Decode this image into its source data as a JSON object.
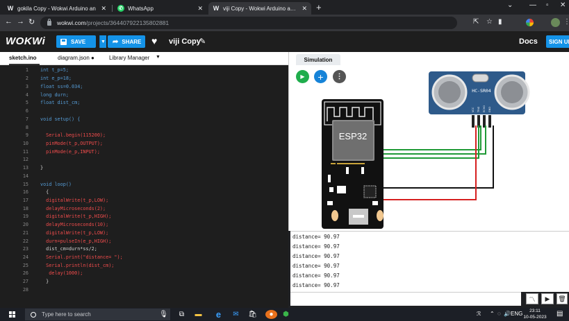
{
  "browser": {
    "tabs": [
      {
        "label": "gokila Copy - Wokwi Arduino an",
        "favicon": "W",
        "active": false
      },
      {
        "label": "WhatsApp",
        "favicon": "whatsapp",
        "active": false
      },
      {
        "label": "viji Copy - Wokwi Arduino and E",
        "favicon": "W",
        "active": true
      }
    ],
    "url_host": "wokwi.com",
    "url_path": "/projects/364407922135802881"
  },
  "wokwi": {
    "logo": "WOKWi",
    "save_label": "SAVE",
    "share_label": "SHARE",
    "project_name": "viji Copy",
    "docs_label": "Docs",
    "signup_label": "SIGN UP"
  },
  "editor": {
    "tabs": [
      "sketch.ino",
      "diagram.json ●",
      "Library Manager"
    ],
    "line_numbers": [
      "1",
      "2",
      "3",
      "4",
      "5",
      "6",
      "7",
      "8",
      "9",
      "10",
      "11",
      "12",
      "13",
      "14",
      "15",
      "16",
      "17",
      "18",
      "19",
      "20",
      "21",
      "22",
      "23",
      "24",
      "25",
      "26",
      "27",
      "28"
    ],
    "lines": [
      "int t_p=5;",
      "int e_p=18;",
      "float ss=0.034;",
      "long durn;",
      "float dist_cm;",
      "",
      "void setup() {",
      "",
      "  Serial.begin(115200);",
      "  pinMode(t_p,OUTPUT);",
      "  pinMode(e_p,INPUT);",
      "",
      "}",
      "",
      "void loop()",
      "  {",
      "  digitalWrite(t_p,LOW);",
      "  delayMicroseconds(2);",
      "  digitalWrite(t_p,HIGH);",
      "  delayMicroseconds(10);",
      "  digitalWrite(t_p,LOW);",
      "  durn=pulseIn(e_p,HIGH);",
      "  dist_cm=durn*ss/2;",
      "  Serial.print(\"distance= \");",
      "  Serial.println(dist_cm);",
      "   delay(1000);",
      "  }",
      ""
    ]
  },
  "simulation": {
    "tab_label": "Simulation",
    "esp_label": "ESP32",
    "sensor_label": "HC-SR04",
    "sensor_pins": [
      "VCC",
      "TRIG",
      "ECHO",
      "GND"
    ],
    "wire_colors": {
      "green": "#1f9a36",
      "red": "#d61f1f",
      "black": "#111111"
    },
    "serial_lines": [
      "distance= 90.97",
      "distance= 90.97",
      "distance= 90.97",
      "distance= 90.97",
      "distance= 90.97",
      "distance= 90.97"
    ]
  },
  "taskbar": {
    "search_placeholder": "Type here to search",
    "tray_lang": "ENG",
    "time": "23:11",
    "date": "10-05-2023"
  }
}
